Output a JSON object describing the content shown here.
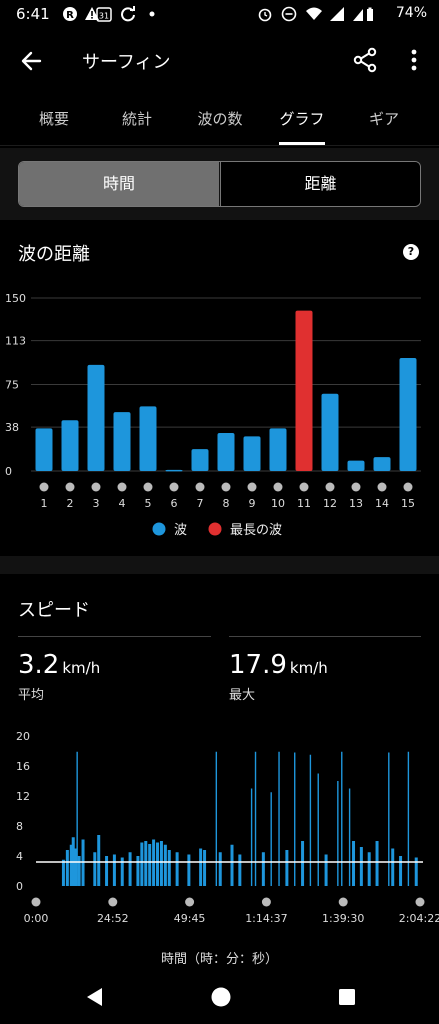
{
  "status": {
    "time": "6:41",
    "battery": "74%"
  },
  "header": {
    "title": "サーフィン"
  },
  "tabs": [
    {
      "label": "概要",
      "active": false
    },
    {
      "label": "統計",
      "active": false
    },
    {
      "label": "波の数",
      "active": false
    },
    {
      "label": "グラフ",
      "active": true
    },
    {
      "label": "ギア",
      "active": false
    }
  ],
  "segment": {
    "time_label": "時間",
    "distance_label": "距離",
    "selected": "時間"
  },
  "wave_chart": {
    "title": "波の距離",
    "legend_wave": "波",
    "legend_longest": "最長の波"
  },
  "speed": {
    "title": "スピード",
    "avg_value": "3.2",
    "avg_unit": "km/h",
    "avg_label": "平均",
    "max_value": "17.9",
    "max_unit": "km/h",
    "max_label": "最大",
    "x_axis_title": "時間（時：分：秒）"
  },
  "colors": {
    "wave": "#1E96DC",
    "longest": "#E03030",
    "avg_line": "#FFFFFF"
  },
  "chart_data": [
    {
      "type": "bar",
      "title": "波の距離",
      "categories": [
        "1",
        "2",
        "3",
        "4",
        "5",
        "6",
        "7",
        "8",
        "9",
        "10",
        "11",
        "12",
        "13",
        "14",
        "15"
      ],
      "series": [
        {
          "name": "波",
          "values": [
            37,
            44,
            92,
            51,
            56,
            1,
            19,
            33,
            30,
            37,
            0,
            67,
            9,
            12,
            98
          ]
        },
        {
          "name": "最長の波",
          "values": [
            0,
            0,
            0,
            0,
            0,
            0,
            0,
            0,
            0,
            0,
            139,
            0,
            0,
            0,
            0
          ]
        }
      ],
      "yticks": [
        0,
        38,
        75,
        113,
        150
      ],
      "ylim": [
        0,
        150
      ],
      "grid": true,
      "legend": "bottom-center"
    },
    {
      "type": "area",
      "title": "スピード",
      "xlabel": "時間（時：分：秒）",
      "xticks": [
        "0:00",
        "24:52",
        "49:45",
        "1:14:37",
        "1:39:30",
        "2:04:22"
      ],
      "yticks": [
        0,
        4,
        8,
        12,
        16,
        20
      ],
      "ylim": [
        0,
        20
      ],
      "average": 3.2,
      "max": 17.9,
      "grid": false,
      "spikes": [
        {
          "t": 0.07,
          "v": 3.5
        },
        {
          "t": 0.08,
          "v": 4.8
        },
        {
          "t": 0.09,
          "v": 5.5
        },
        {
          "t": 0.095,
          "v": 6.5
        },
        {
          "t": 0.1,
          "v": 5.0
        },
        {
          "t": 0.105,
          "v": 17.9
        },
        {
          "t": 0.11,
          "v": 4.0
        },
        {
          "t": 0.12,
          "v": 6.2
        },
        {
          "t": 0.15,
          "v": 4.5
        },
        {
          "t": 0.16,
          "v": 6.8
        },
        {
          "t": 0.18,
          "v": 4.0
        },
        {
          "t": 0.2,
          "v": 4.2
        },
        {
          "t": 0.22,
          "v": 3.8
        },
        {
          "t": 0.24,
          "v": 4.5
        },
        {
          "t": 0.26,
          "v": 4.0
        },
        {
          "t": 0.27,
          "v": 5.8
        },
        {
          "t": 0.28,
          "v": 6.0
        },
        {
          "t": 0.29,
          "v": 5.6
        },
        {
          "t": 0.3,
          "v": 6.2
        },
        {
          "t": 0.31,
          "v": 5.8
        },
        {
          "t": 0.32,
          "v": 6.0
        },
        {
          "t": 0.33,
          "v": 5.5
        },
        {
          "t": 0.34,
          "v": 4.8
        },
        {
          "t": 0.36,
          "v": 4.5
        },
        {
          "t": 0.39,
          "v": 4.2
        },
        {
          "t": 0.42,
          "v": 5.0
        },
        {
          "t": 0.43,
          "v": 4.8
        },
        {
          "t": 0.46,
          "v": 17.9
        },
        {
          "t": 0.47,
          "v": 4.5
        },
        {
          "t": 0.5,
          "v": 5.5
        },
        {
          "t": 0.52,
          "v": 4.2
        },
        {
          "t": 0.55,
          "v": 13.0
        },
        {
          "t": 0.56,
          "v": 17.9
        },
        {
          "t": 0.58,
          "v": 4.5
        },
        {
          "t": 0.6,
          "v": 12.5
        },
        {
          "t": 0.62,
          "v": 17.9
        },
        {
          "t": 0.64,
          "v": 4.8
        },
        {
          "t": 0.66,
          "v": 17.8
        },
        {
          "t": 0.68,
          "v": 6.0
        },
        {
          "t": 0.7,
          "v": 17.5
        },
        {
          "t": 0.72,
          "v": 15.0
        },
        {
          "t": 0.74,
          "v": 4.2
        },
        {
          "t": 0.77,
          "v": 14.0
        },
        {
          "t": 0.78,
          "v": 17.9
        },
        {
          "t": 0.8,
          "v": 13.0
        },
        {
          "t": 0.81,
          "v": 6.0
        },
        {
          "t": 0.83,
          "v": 5.2
        },
        {
          "t": 0.85,
          "v": 4.5
        },
        {
          "t": 0.87,
          "v": 6.0
        },
        {
          "t": 0.9,
          "v": 17.8
        },
        {
          "t": 0.91,
          "v": 5.0
        },
        {
          "t": 0.93,
          "v": 4.0
        },
        {
          "t": 0.95,
          "v": 17.9
        },
        {
          "t": 0.97,
          "v": 3.8
        }
      ]
    }
  ]
}
